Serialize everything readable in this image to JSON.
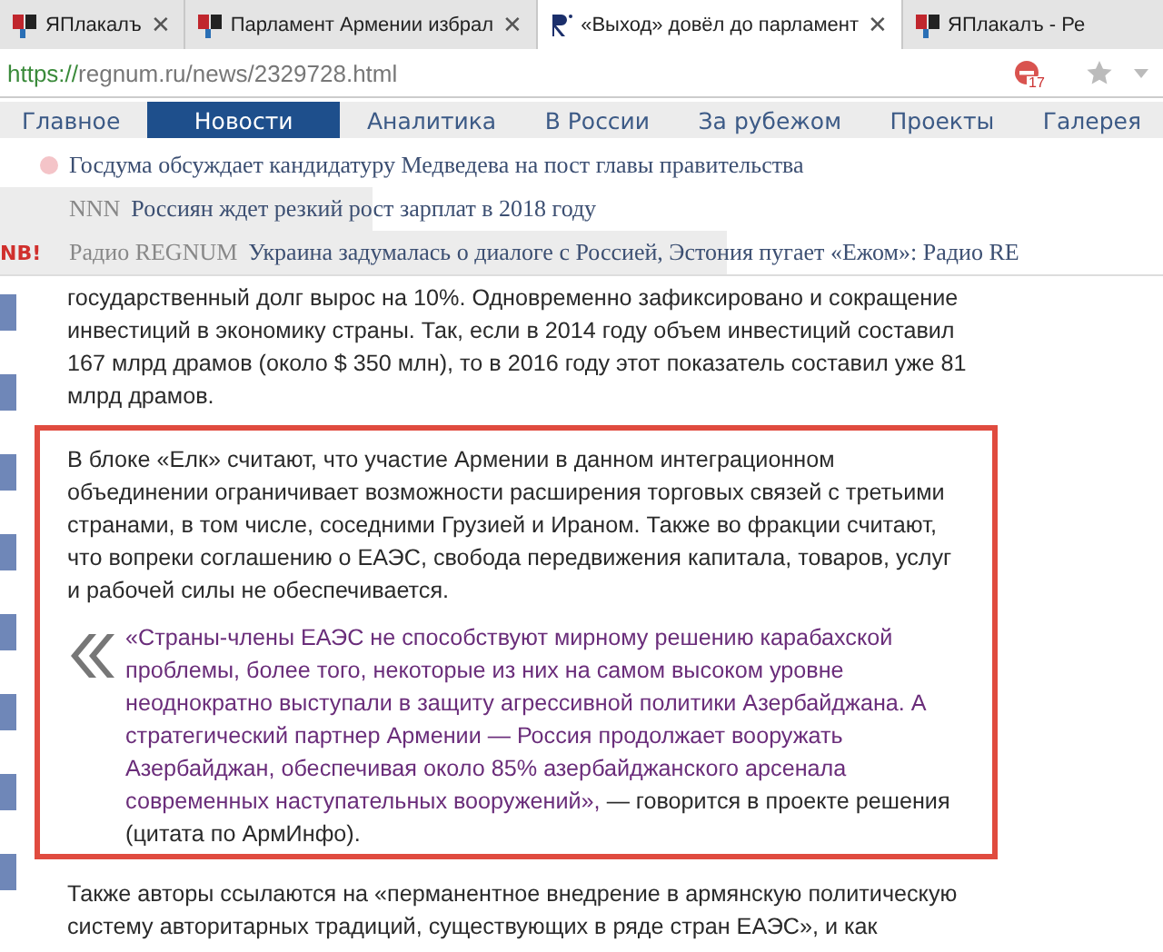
{
  "tabs": [
    {
      "title": "ЯПлакалъ",
      "kind": "yap",
      "close": "✕",
      "selected": false
    },
    {
      "title": "Парламент Армении избрал",
      "kind": "yap",
      "close": "✕",
      "selected": false
    },
    {
      "title": "«Выход» довёл до парламент",
      "kind": "regnum",
      "close": "✕",
      "selected": true
    },
    {
      "title": "ЯПлакалъ - Ре",
      "kind": "yap",
      "selected": false
    }
  ],
  "address_bar": {
    "scheme": "https://",
    "rest": "regnum.ru/news/2329728.html",
    "blocked_count": "17"
  },
  "nav": [
    {
      "label": "Главное",
      "selected": false
    },
    {
      "label": "Новости",
      "selected": true
    },
    {
      "label": "Аналитика",
      "selected": false
    },
    {
      "label": "В России",
      "selected": false
    },
    {
      "label": "За рубежом",
      "selected": false
    },
    {
      "label": "Проекты",
      "selected": false
    },
    {
      "label": "Галерея",
      "selected": false
    }
  ],
  "ticker": [
    {
      "kind": "dot",
      "color": "#f4c4c8",
      "headline": "Госдума обсуждает кандидатуру Медведева на пост главы правительства"
    },
    {
      "kind": "source",
      "source": "NNN",
      "headline": "Россиян ждет резкий рост зарплат в 2018 году"
    },
    {
      "kind": "badge",
      "badge": "NB!",
      "source": "Радио REGNUM",
      "headline": "Украина задумалась о диалоге с Россией, Эстония пугает «Ежом»: Радио RE"
    }
  ],
  "article": [
    {
      "kind": "text",
      "text": "государственный долг вырос на 10%. Одновременно зафиксировано и сокращение инвестиций в экономику страны. Так, если в 2014 году объем инвестиций составил 167 млрд драмов (около $ 350 млн), то в 2016 году этот показатель составил уже 81 млрд драмов."
    },
    {
      "kind": "highlight",
      "text": "В блоке «Елк» считают, что участие Армении в данном интеграционном объединении ограничивает возможности расширения торговых связей с третьими странами, в том числе, соседними Грузией и Ираном. Также во фракции считают, что вопреки соглашению о ЕАЭС, свобода передвижения капитала, товаров, услуг и рабочей силы не обеспечивается.",
      "quote": "«Страны-члены ЕАЭС не способствуют мирному решению карабахской проблемы, более того, некоторые из них на самом высоком уровне неоднократно выступали в защиту агрессивной политики Азербайджана. А стратегический партнер Армении — Россия продолжает вооружать Азербайджан, обеспечивая около 85% азербайджанского арсенала современных наступательных вооружений»,",
      "attribution": "— говорится в проекте решения (цитата по АрмИнфо)."
    },
    {
      "kind": "text",
      "text": "Также авторы ссылаются на «перманентное внедрение в армянскую политическую систему авторитарных традиций, существующих в ряде стран ЕАЭС», и как"
    }
  ]
}
